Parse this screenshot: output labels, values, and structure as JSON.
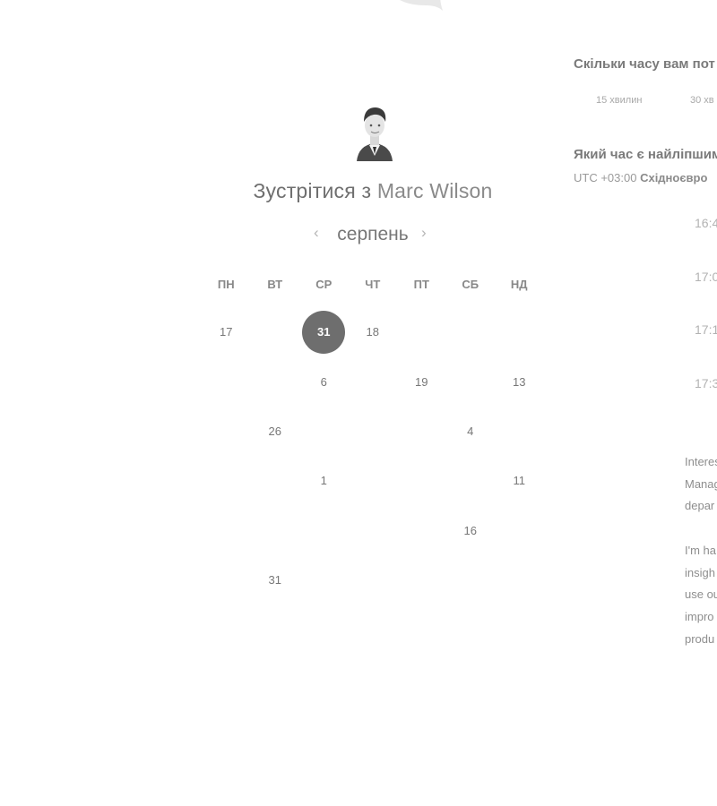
{
  "header": {
    "meeting_title_prefix": "Зустрітися з",
    "host_name": "Marc Wilson"
  },
  "calendar": {
    "month": "серпень",
    "weekdays": [
      "ПН",
      "ВТ",
      "СР",
      "ЧТ",
      "ПТ",
      "СБ",
      "НД"
    ],
    "rows": [
      [
        "17",
        "",
        "31",
        "18",
        "",
        "",
        ""
      ],
      [
        "",
        "",
        "6",
        "",
        "19",
        "",
        "13"
      ],
      [
        "",
        "26",
        "",
        "",
        "",
        "4",
        ""
      ],
      [
        "",
        "",
        "1",
        "",
        "",
        "",
        "11"
      ],
      [
        "",
        "",
        "",
        "",
        "",
        "16",
        ""
      ],
      [
        "",
        "31",
        "",
        "",
        "",
        "",
        ""
      ]
    ],
    "selected": "31"
  },
  "duration": {
    "title": "Скільки часу вам пот",
    "options": [
      "15 хвилин",
      "30 хв"
    ]
  },
  "time_selection": {
    "title": "Який час є найліпшим",
    "timezone_offset": "UTC +03:00",
    "timezone_name": "Східноєвро",
    "slots": [
      "16:4",
      "17:0",
      "17:1",
      "17:3"
    ]
  },
  "description": {
    "paragraph1": [
      "Interes",
      "Manag",
      "depar"
    ],
    "paragraph2": [
      "I'm ha",
      "insigh",
      "use ou",
      "impro",
      "produ"
    ]
  },
  "colors": {
    "selected_day": "#6e6e6e",
    "text": "#777777"
  }
}
